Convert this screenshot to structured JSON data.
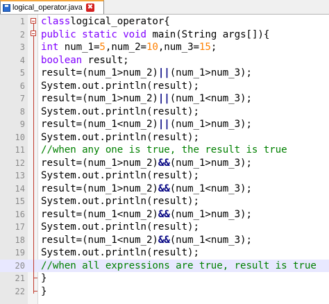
{
  "tab": {
    "title": "logical_operator.java",
    "close_symbol": "✖"
  },
  "lines": [
    {
      "n": "1",
      "tokens": [
        [
          "kw",
          "class"
        ],
        [
          "",
          "logical_operator{"
        ]
      ]
    },
    {
      "n": "2",
      "tokens": [
        [
          "kw",
          "public"
        ],
        [
          "",
          " "
        ],
        [
          "kw",
          "static"
        ],
        [
          "",
          " "
        ],
        [
          "kw",
          "void"
        ],
        [
          "",
          " main(String args[]){"
        ]
      ]
    },
    {
      "n": "3",
      "tokens": [
        [
          "type",
          "int"
        ],
        [
          "",
          " num_1="
        ],
        [
          "num",
          "5"
        ],
        [
          "",
          ",num_2="
        ],
        [
          "num",
          "10"
        ],
        [
          "",
          ",num_3="
        ],
        [
          "num",
          "15"
        ],
        [
          "",
          ";"
        ]
      ]
    },
    {
      "n": "4",
      "tokens": [
        [
          "type",
          "boolean"
        ],
        [
          "",
          " result;"
        ]
      ]
    },
    {
      "n": "5",
      "tokens": [
        [
          "",
          "result=(num_1>num_2)"
        ],
        [
          "op",
          "||"
        ],
        [
          "",
          "(num_1>num_3);"
        ]
      ]
    },
    {
      "n": "6",
      "tokens": [
        [
          "",
          "System.out.println(result);"
        ]
      ]
    },
    {
      "n": "7",
      "tokens": [
        [
          "",
          "result=(num_1>num_2)"
        ],
        [
          "op",
          "||"
        ],
        [
          "",
          "(num_1<num_3);"
        ]
      ]
    },
    {
      "n": "8",
      "tokens": [
        [
          "",
          "System.out.println(result);"
        ]
      ]
    },
    {
      "n": "9",
      "tokens": [
        [
          "",
          "result=(num_1<num_2)"
        ],
        [
          "op",
          "||"
        ],
        [
          "",
          "(num_1>num_3);"
        ]
      ]
    },
    {
      "n": "10",
      "tokens": [
        [
          "",
          "System.out.println(result);"
        ]
      ]
    },
    {
      "n": "11",
      "tokens": [
        [
          "cm",
          "//when any one is true, the result is true"
        ]
      ]
    },
    {
      "n": "12",
      "tokens": [
        [
          "",
          "result=(num_1>num_2)"
        ],
        [
          "op",
          "&&"
        ],
        [
          "",
          "(num_1>num_3);"
        ]
      ]
    },
    {
      "n": "13",
      "tokens": [
        [
          "",
          "System.out.println(result);"
        ]
      ]
    },
    {
      "n": "14",
      "tokens": [
        [
          "",
          "result=(num_1>num_2)"
        ],
        [
          "op",
          "&&"
        ],
        [
          "",
          "(num_1<num_3);"
        ]
      ]
    },
    {
      "n": "15",
      "tokens": [
        [
          "",
          "System.out.println(result);"
        ]
      ]
    },
    {
      "n": "16",
      "tokens": [
        [
          "",
          "result=(num_1<num_2)"
        ],
        [
          "op",
          "&&"
        ],
        [
          "",
          "(num_1>num_3);"
        ]
      ]
    },
    {
      "n": "17",
      "tokens": [
        [
          "",
          "System.out.println(result);"
        ]
      ]
    },
    {
      "n": "18",
      "tokens": [
        [
          "",
          "result=(num_1<num_2)"
        ],
        [
          "op",
          "&&"
        ],
        [
          "",
          "(num_1<num_3);"
        ]
      ]
    },
    {
      "n": "19",
      "tokens": [
        [
          "",
          "System.out.println(result);"
        ]
      ]
    },
    {
      "n": "20",
      "tokens": [
        [
          "cm",
          "//when all expressions are true, result is true"
        ]
      ]
    },
    {
      "n": "21",
      "tokens": [
        [
          "",
          "}"
        ]
      ]
    },
    {
      "n": "22",
      "tokens": [
        [
          "",
          "}"
        ]
      ]
    }
  ],
  "colors": {
    "keyword": "#8000ff",
    "number": "#ff8000",
    "operator": "#000080",
    "comment": "#008000",
    "tab_accent": "#f3a53d",
    "current_line": "#e8e8ff"
  },
  "icons": {
    "tab_file": "save-disk-icon",
    "tab_close": "close-icon",
    "fold_open": "fold-minus-icon"
  },
  "current_line": 20
}
